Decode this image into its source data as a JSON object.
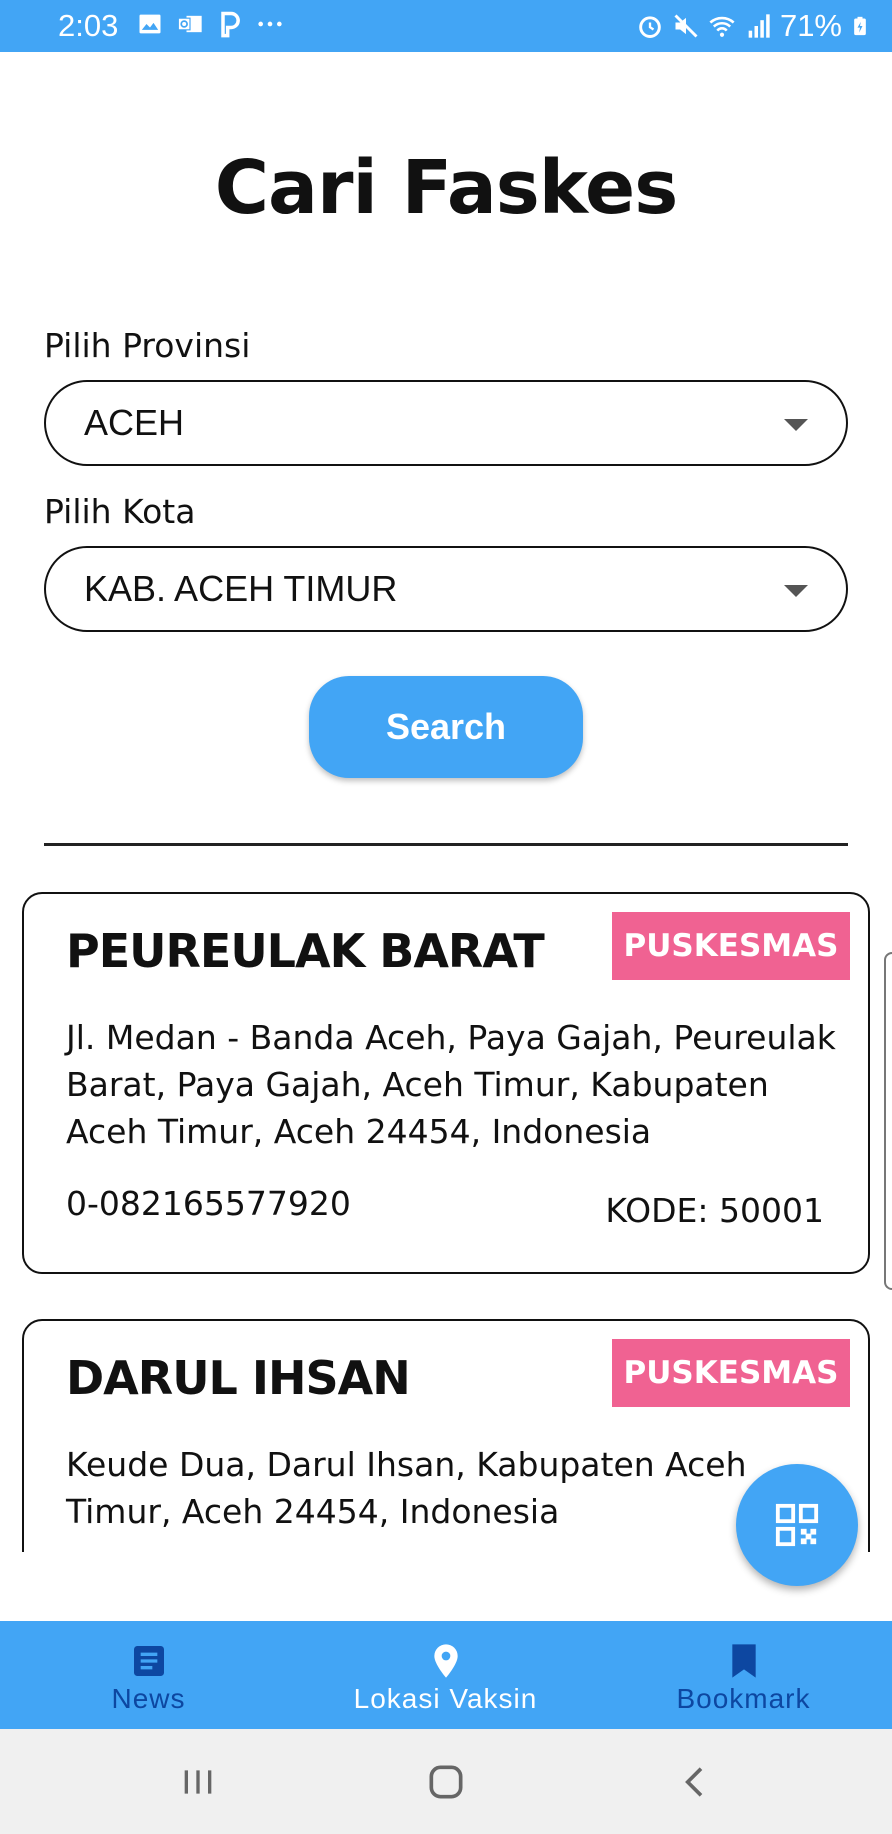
{
  "status_bar": {
    "time": "2:03",
    "battery": "71%",
    "left_icons": [
      "image-icon",
      "outlook-icon",
      "parking-icon",
      "more-icon"
    ],
    "right_icons": [
      "alarm-icon",
      "mute-icon",
      "wifi-icon",
      "signal-icon",
      "battery-icon"
    ]
  },
  "page": {
    "title": "Cari Faskes"
  },
  "form": {
    "province_label": "Pilih Provinsi",
    "province_value": "ACEH",
    "city_label": "Pilih Kota",
    "city_value": "KAB. ACEH TIMUR",
    "search_label": "Search"
  },
  "results": [
    {
      "name": "PEUREULAK BARAT",
      "type": "PUSKESMAS",
      "address": "Jl. Medan - Banda Aceh, Paya Gajah, Peureulak Barat, Paya Gajah, Aceh Timur, Kabupaten Aceh Timur, Aceh 24454, Indonesia",
      "phone": "0-082165577920",
      "code": "KODE: 50001"
    },
    {
      "name": "DARUL IHSAN",
      "type": "PUSKESMAS",
      "address": "Keude Dua, Darul Ihsan, Kabupaten Aceh Timur, Aceh 24454, Indonesia"
    }
  ],
  "fab": {
    "icon": "qr-code-icon"
  },
  "bottom_nav": [
    {
      "label": "News",
      "icon": "news-icon",
      "active": false
    },
    {
      "label": "Lokasi Vaksin",
      "icon": "location-pin-icon",
      "active": true
    },
    {
      "label": "Bookmark",
      "icon": "bookmark-icon",
      "active": false
    }
  ],
  "colors": {
    "primary": "#42a5f5",
    "badge": "#f06292",
    "nav_inactive": "#0d47a1"
  }
}
